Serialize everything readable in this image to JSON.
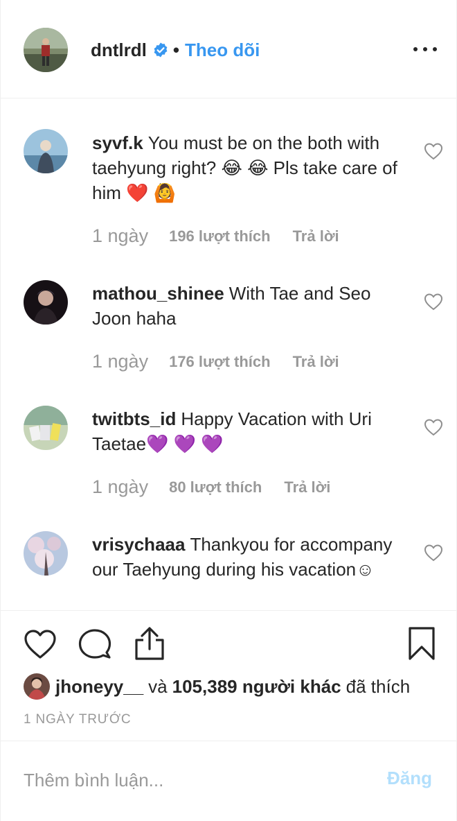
{
  "post_header": {
    "username": "dntlrdl",
    "separator": "•",
    "follow_label": "Theo dõi"
  },
  "comments": [
    {
      "username": "syvf.k",
      "text": "You must be on the both with taehyung right? 😂 😂  Pls take care of him ❤️ 🙆",
      "time": "1 ngày",
      "likes": "196 lượt thích",
      "reply": "Trả lời"
    },
    {
      "username": "mathou_shinee",
      "text": "With Tae and Seo Joon haha",
      "time": "1 ngày",
      "likes": "176 lượt thích",
      "reply": "Trả lời"
    },
    {
      "username": "twitbts_id",
      "text": "Happy Vacation with Uri Taetae💜 💜 💜",
      "time": "1 ngày",
      "likes": "80 lượt thích",
      "reply": "Trả lời"
    },
    {
      "username": "vrisychaaa",
      "text": "Thankyou for accompany our Taehyung during his vacation☺",
      "time": "",
      "likes": "",
      "reply": ""
    }
  ],
  "likes_summary": {
    "liker_username": "jhoneyy__",
    "connector": "và",
    "count_text": "105,389 người khác",
    "suffix": "đã thích"
  },
  "timestamp": "1 NGÀY TRƯỚC",
  "add_comment": {
    "placeholder": "Thêm bình luận...",
    "post_label": "Đăng"
  },
  "icons": {
    "verified": "verified-badge-icon",
    "more": "more-options-icon",
    "like": "heart-icon",
    "comment": "comment-bubble-icon",
    "share": "share-icon",
    "save": "bookmark-icon"
  },
  "colors": {
    "link_blue": "#3897f0",
    "post_disabled": "#b2dffc",
    "muted_text": "#999999",
    "text": "#262626"
  }
}
